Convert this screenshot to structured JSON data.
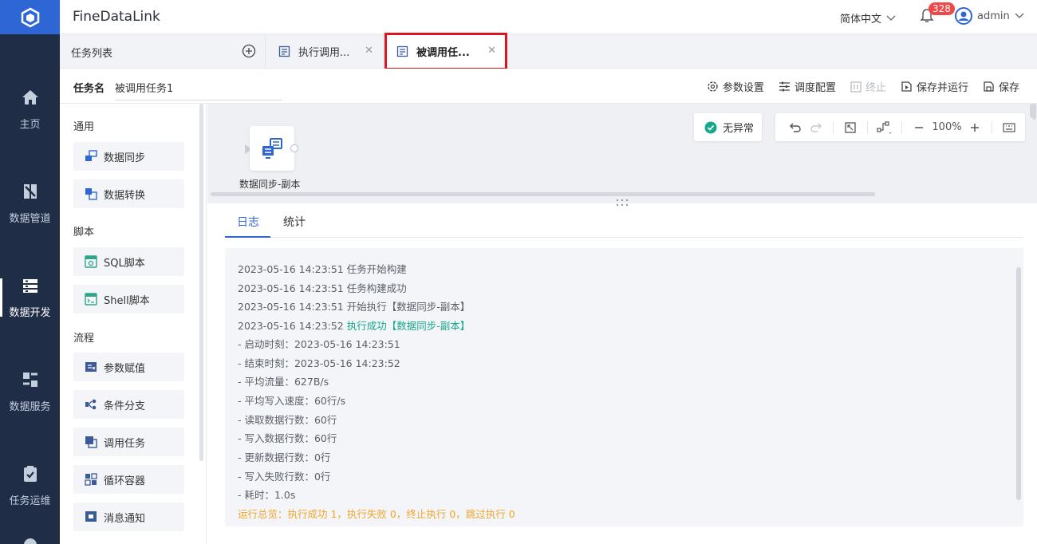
{
  "app": {
    "title": "FineDataLink",
    "language": "简体中文",
    "notification_count": "328",
    "user": "admin"
  },
  "nav": {
    "items": [
      {
        "label": "主页",
        "icon": "home-icon"
      },
      {
        "label": "数据管道",
        "icon": "pipeline-icon"
      },
      {
        "label": "数据开发",
        "icon": "dev-icon"
      },
      {
        "label": "数据服务",
        "icon": "service-icon"
      },
      {
        "label": "任务运维",
        "icon": "ops-icon"
      }
    ],
    "active": "数据开发"
  },
  "tabbar": {
    "task_list_label": "任务列表",
    "tabs": [
      {
        "label": "执行调用..."
      },
      {
        "label": "被调用任..."
      }
    ]
  },
  "task": {
    "name_label": "任务名",
    "name_value": "被调用任务1",
    "toolbar": {
      "params": "参数设置",
      "schedule": "调度配置",
      "stop": "终止",
      "save_run": "保存并运行",
      "save": "保存"
    }
  },
  "panel": {
    "groups": [
      {
        "title": "通用",
        "items": [
          "数据同步",
          "数据转换"
        ]
      },
      {
        "title": "脚本",
        "items": [
          "SQL脚本",
          "Shell脚本"
        ]
      },
      {
        "title": "流程",
        "items": [
          "参数赋值",
          "条件分支",
          "调用任务",
          "循环容器",
          "消息通知"
        ]
      }
    ]
  },
  "canvas": {
    "node_label": "数据同步-副本",
    "status": "无异常",
    "zoom": "100%"
  },
  "log": {
    "tabs": [
      "日志",
      "统计"
    ],
    "lines": [
      {
        "time": "2023-05-16 14:23:51",
        "text": "任务开始构建"
      },
      {
        "time": "2023-05-16 14:23:51",
        "text": "任务构建成功"
      },
      {
        "time": "2023-05-16 14:23:51",
        "text": "开始执行【数据同步-副本】"
      },
      {
        "time": "2023-05-16 14:23:52",
        "text": "执行成功【数据同步-副本】"
      },
      {
        "text": "- 启动时刻：2023-05-16 14:23:51"
      },
      {
        "text": "- 结束时刻：2023-05-16 14:23:52"
      },
      {
        "text": "- 平均流量：627B/s"
      },
      {
        "text": "- 平均写入速度：60行/s"
      },
      {
        "text": "- 读取数据行数：60行"
      },
      {
        "text": "- 写入数据行数：60行"
      },
      {
        "text": "- 更新数据行数：0行"
      },
      {
        "text": "- 写入失败行数：0行"
      },
      {
        "text": "- 耗时：1.0s"
      }
    ],
    "summary": "运行总览：执行成功 1，执行失败 0，终止执行 0，跳过执行 0"
  },
  "colors": {
    "accent": "#2f66d6",
    "nav_bg": "#1f2d46",
    "success": "#17a78a",
    "warning": "#f2a52a",
    "highlight": "#e0141e"
  }
}
